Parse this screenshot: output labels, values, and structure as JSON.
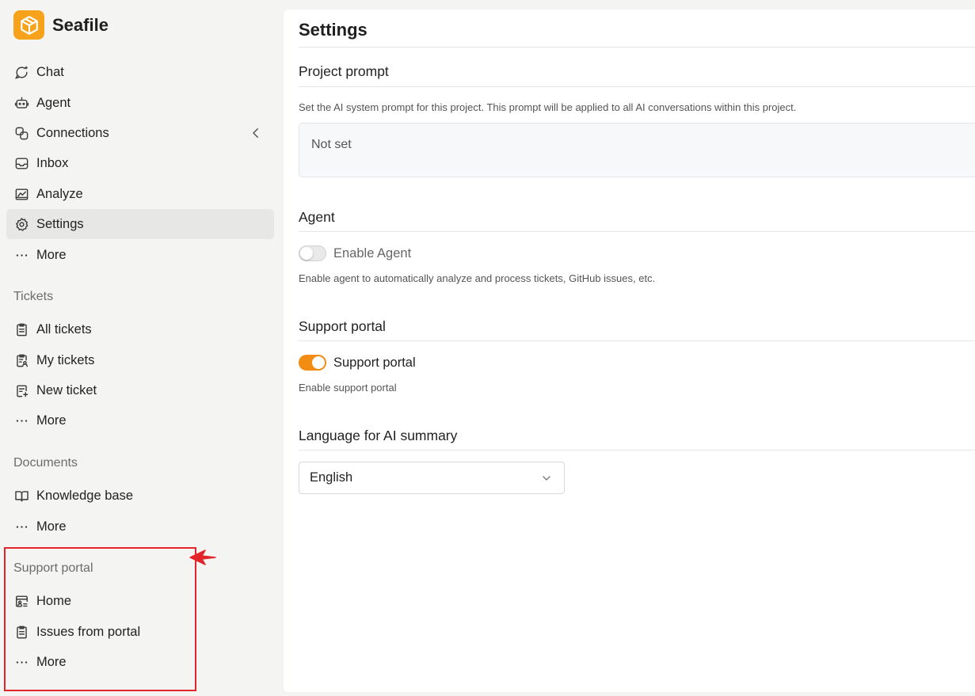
{
  "brand": {
    "name": "Seafile",
    "accent": "#f7a21b"
  },
  "nav": {
    "items": [
      {
        "label": "Chat",
        "icon": "chat-icon"
      },
      {
        "label": "Agent",
        "icon": "robot-icon"
      },
      {
        "label": "Connections",
        "icon": "link-icon"
      },
      {
        "label": "Inbox",
        "icon": "inbox-icon"
      },
      {
        "label": "Analyze",
        "icon": "chart-icon"
      },
      {
        "label": "Settings",
        "icon": "gear-icon",
        "active": true
      },
      {
        "label": "More",
        "icon": "more-icon"
      }
    ]
  },
  "tickets": {
    "title": "Tickets",
    "items": [
      {
        "label": "All tickets",
        "icon": "clipboard-icon"
      },
      {
        "label": "My tickets",
        "icon": "clipboard-user-icon"
      },
      {
        "label": "New ticket",
        "icon": "clipboard-plus-icon"
      },
      {
        "label": "More",
        "icon": "more-icon"
      }
    ]
  },
  "documents": {
    "title": "Documents",
    "items": [
      {
        "label": "Knowledge base",
        "icon": "book-icon"
      },
      {
        "label": "More",
        "icon": "more-icon"
      }
    ]
  },
  "portal": {
    "title": "Support portal",
    "items": [
      {
        "label": "Home",
        "icon": "portal-home-icon"
      },
      {
        "label": "Issues from portal",
        "icon": "clipboard-icon"
      },
      {
        "label": "More",
        "icon": "more-icon"
      }
    ]
  },
  "settings": {
    "title": "Settings",
    "project_prompt": {
      "heading": "Project prompt",
      "description": "Set the AI system prompt for this project. This prompt will be applied to all AI conversations within this project.",
      "value": "Not set"
    },
    "agent": {
      "heading": "Agent",
      "toggle_label": "Enable Agent",
      "enabled": false,
      "description": "Enable agent to automatically analyze and process tickets, GitHub issues, etc."
    },
    "support_portal": {
      "heading": "Support portal",
      "toggle_label": "Support portal",
      "enabled": true,
      "description": "Enable support portal"
    },
    "language": {
      "heading": "Language for AI summary",
      "selected": "English"
    }
  },
  "colors": {
    "toggle_on": "#f28c13",
    "highlight": "#e3242b"
  }
}
